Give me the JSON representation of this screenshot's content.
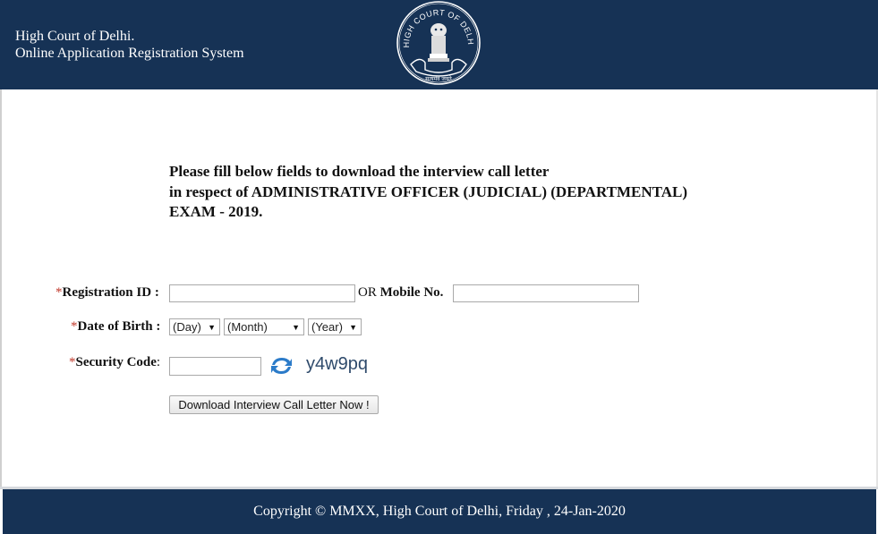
{
  "header": {
    "title_line1": "High Court of Delhi.",
    "title_line2": "Online Application Registration System",
    "emblem_text": "HIGH COURT OF DELHI",
    "emblem_motto": "सत्यमेव जयते",
    "background_color": "#163255"
  },
  "instructions": {
    "line1": "Please fill below fields to download the interview call letter",
    "line2": "in respect of ADMINISTRATIVE OFFICER (JUDICIAL) (DEPARTMENTAL)",
    "line3": "EXAM - 2019."
  },
  "form": {
    "required_marker": "*",
    "registration_id": {
      "label": "Registration ID :",
      "value": "",
      "placeholder": ""
    },
    "or_text": "OR",
    "mobile_no": {
      "label": "Mobile No.",
      "value": "",
      "placeholder": ""
    },
    "date_of_birth": {
      "label": "Date of Birth :",
      "day": "(Day)",
      "month": "(Month)",
      "year": "(Year)"
    },
    "security_code": {
      "label": "Security Code",
      "colon": ":",
      "value": "",
      "captcha": "y4w9pq",
      "refresh_icon": "refresh-icon"
    },
    "submit_label": "Download Interview Call Letter Now !"
  },
  "footer": {
    "text": "Copyright © MMXX, High Court of Delhi, Friday , 24-Jan-2020"
  }
}
